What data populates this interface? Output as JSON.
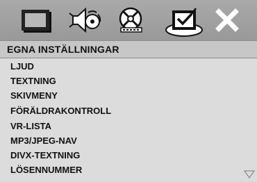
{
  "tabs": [
    {
      "id": "general",
      "icon": "display-monitor-icon"
    },
    {
      "id": "audio",
      "icon": "speaker-icon"
    },
    {
      "id": "video",
      "icon": "video-reel-icon"
    },
    {
      "id": "preferences",
      "icon": "checked-panel-icon",
      "selected": true
    },
    {
      "id": "exit",
      "icon": "close-icon"
    }
  ],
  "section": {
    "title": "EGNA INSTÄLLNINGAR"
  },
  "menu": {
    "items": [
      {
        "label": "LJUD"
      },
      {
        "label": "TEXTNING"
      },
      {
        "label": "SKIVMENY"
      },
      {
        "label": "FÖRÄLDRAKONTROLL"
      },
      {
        "label": "VR-LISTA"
      },
      {
        "label": "MP3/JPEG-NAV"
      },
      {
        "label": "DIVX-TEXTNING"
      },
      {
        "label": "LÖSENNUMMER"
      }
    ],
    "more_below_icon": "triangle-down-icon"
  },
  "colors": {
    "toolbar": "#a3a3a3",
    "title_bar": "#c7c7c7",
    "menu_background": "#dcdcdc",
    "text": "#111111",
    "icon_white": "#ffffff",
    "icon_dark": "#1a1a1a"
  }
}
